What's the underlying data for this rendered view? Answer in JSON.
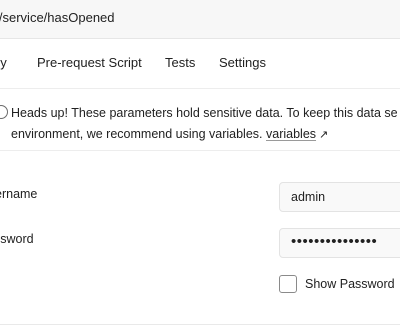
{
  "request": {
    "url": "i/service/hasOpened"
  },
  "tabs": [
    {
      "label": "dy"
    },
    {
      "label": "Pre-request Script"
    },
    {
      "label": "Tests"
    },
    {
      "label": "Settings"
    }
  ],
  "notice": {
    "icon": "info-icon",
    "line1": "Heads up! These parameters hold sensitive data. To keep this data se",
    "line2": "environment, we recommend using variables.",
    "link": "variables",
    "link_icon": "arrow-up-right-icon",
    "link_arrow": "↗"
  },
  "auth": {
    "username_label": "ername",
    "username_value": "admin",
    "password_label": "ssword",
    "password_value": "•••••••••••••••",
    "show_password_label": "Show Password",
    "show_password_checked": false
  }
}
